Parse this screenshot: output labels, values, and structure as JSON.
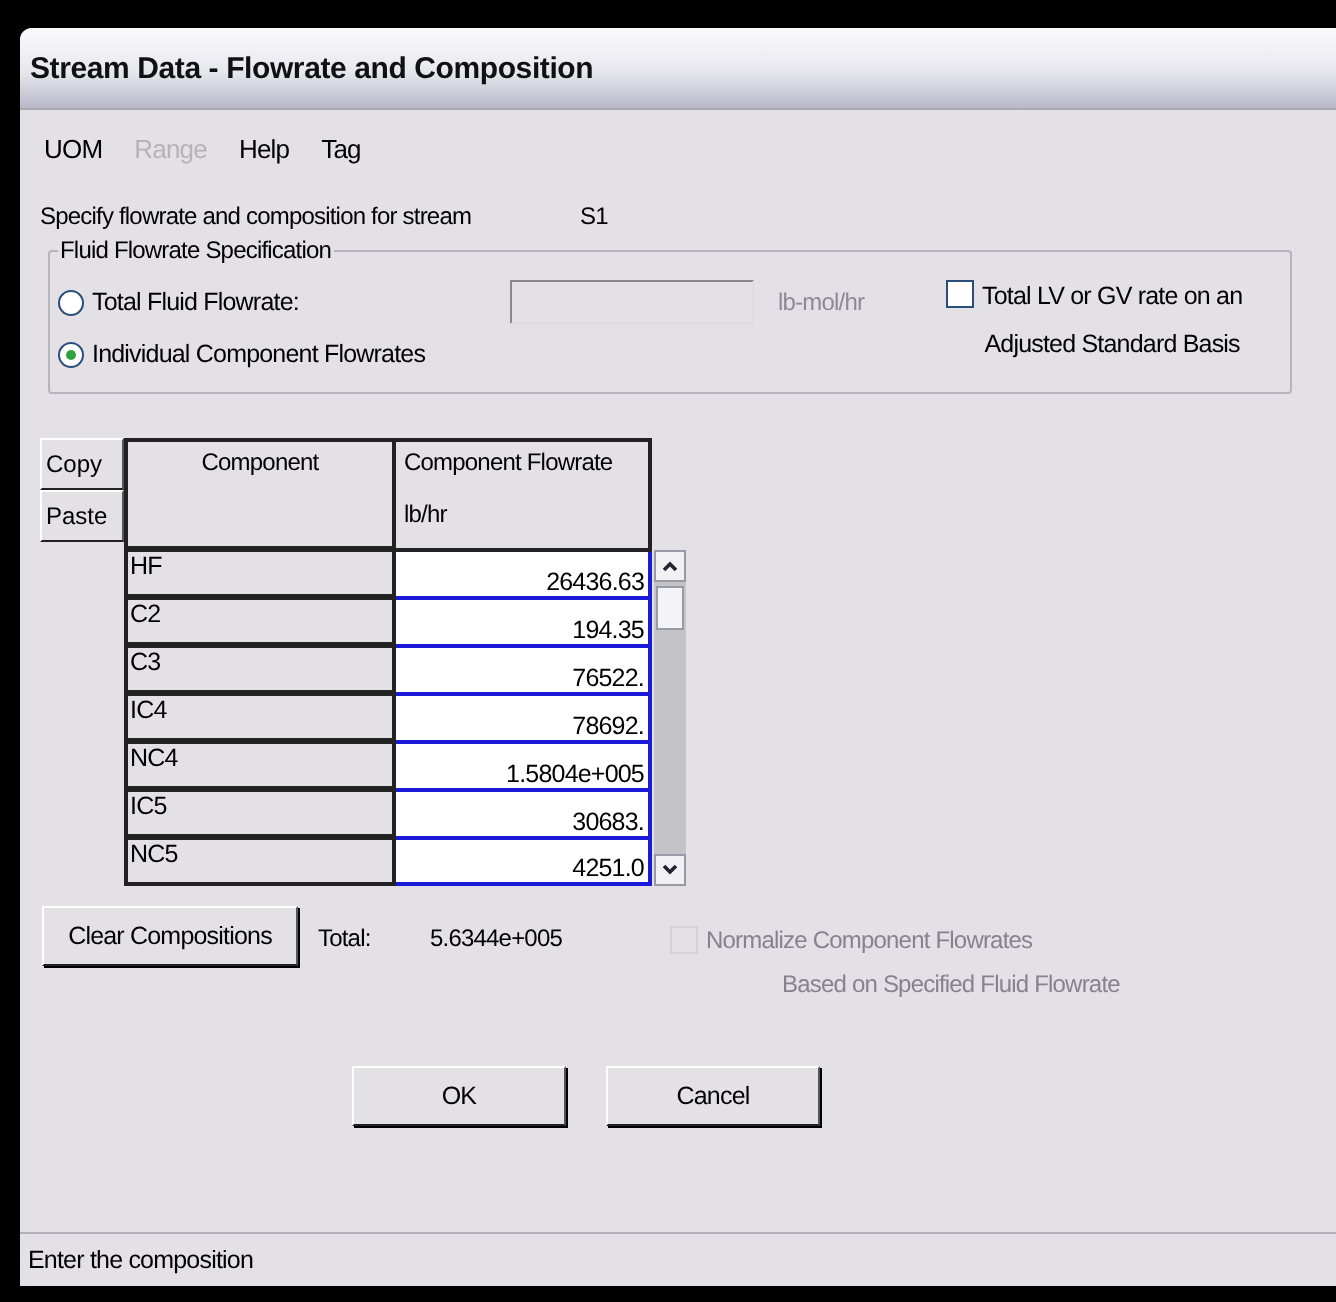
{
  "window": {
    "title": "Stream Data - Flowrate and Composition"
  },
  "menu": [
    {
      "label": "UOM",
      "disabled": false
    },
    {
      "label": "Range",
      "disabled": true
    },
    {
      "label": "Help",
      "disabled": false
    },
    {
      "label": "Tag",
      "disabled": false
    }
  ],
  "prompt": {
    "label": "Specify flowrate and composition for stream",
    "stream": "S1"
  },
  "spec_group": {
    "title": "Fluid Flowrate Specification",
    "options": [
      {
        "label": "Total Fluid Flowrate:",
        "selected": false
      },
      {
        "label": "Individual Component Flowrates",
        "selected": true
      }
    ],
    "total_unit": "lb-mol/hr",
    "standard_basis": {
      "label_lines": [
        "Total LV or GV rate on an",
        "Adjusted Standard Basis"
      ],
      "checked": false
    }
  },
  "side_buttons": [
    "Copy",
    "Paste"
  ],
  "table": {
    "columns": [
      {
        "title": "Component"
      },
      {
        "title": "Component Flowrate",
        "unit": "lb/hr"
      }
    ],
    "rows": [
      {
        "component": "HF",
        "flowrate": "26436.63"
      },
      {
        "component": "C2",
        "flowrate": "194.35"
      },
      {
        "component": "C3",
        "flowrate": "76522."
      },
      {
        "component": "IC4",
        "flowrate": "78692."
      },
      {
        "component": "NC4",
        "flowrate": "1.5804e+005"
      },
      {
        "component": "IC5",
        "flowrate": "30683."
      },
      {
        "component": "NC5",
        "flowrate": "4251.0"
      }
    ]
  },
  "clear_button": "Clear Compositions",
  "total": {
    "label": "Total:",
    "value": "5.6344e+005"
  },
  "normalize": {
    "label_lines": [
      "Normalize Component Flowrates",
      "Based on Specified Fluid Flowrate"
    ],
    "checked": false,
    "disabled": true
  },
  "buttons": [
    "OK",
    "Cancel"
  ],
  "status_bar": "Enter the composition"
}
